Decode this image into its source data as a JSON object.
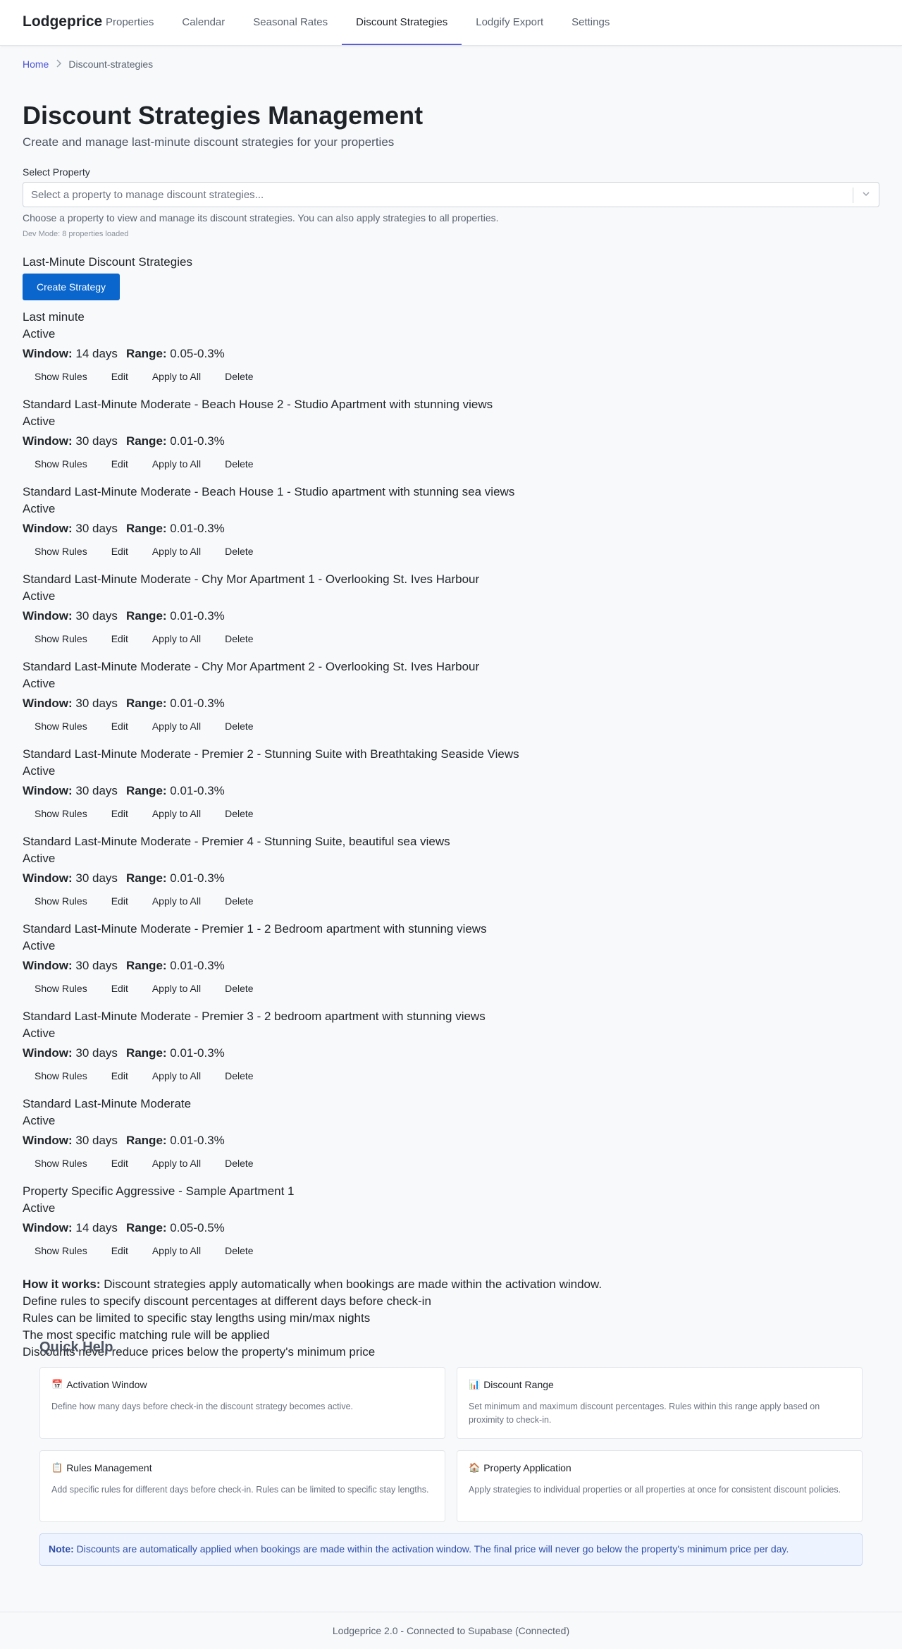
{
  "header": {
    "brand": "Lodgeprice",
    "nav": [
      {
        "label": "Properties",
        "active": false
      },
      {
        "label": "Calendar",
        "active": false
      },
      {
        "label": "Seasonal Rates",
        "active": false
      },
      {
        "label": "Discount Strategies",
        "active": true
      },
      {
        "label": "Lodgify Export",
        "active": false
      },
      {
        "label": "Settings",
        "active": false
      }
    ]
  },
  "breadcrumb": {
    "home": "Home",
    "current": "Discount-strategies"
  },
  "page": {
    "title": "Discount Strategies Management",
    "subtitle": "Create and manage last-minute discount strategies for your properties"
  },
  "property_select": {
    "label": "Select Property",
    "placeholder": "Select a property to manage discount strategies...",
    "help": "Choose a property to view and manage its discount strategies. You can also apply strategies to all properties.",
    "dev_mode": "Dev Mode: 8 properties loaded"
  },
  "strategies_section": {
    "title": "Last-Minute Discount Strategies",
    "create_label": "Create Strategy",
    "window_label": "Window:",
    "range_label": "Range:",
    "actions": {
      "show_rules": "Show Rules",
      "edit": "Edit",
      "apply_all": "Apply to All",
      "delete": "Delete"
    },
    "items": [
      {
        "name": "Last minute",
        "status": "Active",
        "window": "14 days",
        "range": "0.05-0.3%"
      },
      {
        "name": "Standard Last-Minute Moderate - Beach House 2 - Studio Apartment with stunning views",
        "status": "Active",
        "window": "30 days",
        "range": "0.01-0.3%"
      },
      {
        "name": "Standard Last-Minute Moderate - Beach House 1 - Studio apartment with stunning sea views",
        "status": "Active",
        "window": "30 days",
        "range": "0.01-0.3%"
      },
      {
        "name": "Standard Last-Minute Moderate - Chy Mor Apartment 1 - Overlooking St. Ives Harbour",
        "status": "Active",
        "window": "30 days",
        "range": "0.01-0.3%"
      },
      {
        "name": "Standard Last-Minute Moderate - Chy Mor Apartment 2 - Overlooking St. Ives Harbour",
        "status": "Active",
        "window": "30 days",
        "range": "0.01-0.3%"
      },
      {
        "name": "Standard Last-Minute Moderate - Premier 2 - Stunning Suite with Breathtaking Seaside Views",
        "status": "Active",
        "window": "30 days",
        "range": "0.01-0.3%"
      },
      {
        "name": "Standard Last-Minute Moderate - Premier 4 - Stunning Suite, beautiful sea views",
        "status": "Active",
        "window": "30 days",
        "range": "0.01-0.3%"
      },
      {
        "name": "Standard Last-Minute Moderate - Premier 1 - 2 Bedroom apartment with stunning views",
        "status": "Active",
        "window": "30 days",
        "range": "0.01-0.3%"
      },
      {
        "name": "Standard Last-Minute Moderate - Premier 3 - 2 bedroom apartment with stunning views",
        "status": "Active",
        "window": "30 days",
        "range": "0.01-0.3%"
      },
      {
        "name": "Standard Last-Minute Moderate",
        "status": "Active",
        "window": "30 days",
        "range": "0.01-0.3%"
      },
      {
        "name": "Property Specific Aggressive - Sample Apartment 1",
        "status": "Active",
        "window": "14 days",
        "range": "0.05-0.5%"
      }
    ]
  },
  "how_it_works": {
    "label": "How it works:",
    "text": " Discount strategies apply automatically when bookings are made within the activation window.",
    "points": [
      "Define rules to specify discount percentages at different days before check-in",
      "Rules can be limited to specific stay lengths using min/max nights",
      "The most specific matching rule will be applied",
      "Discounts never reduce prices below the property's minimum price"
    ]
  },
  "quick_help": {
    "title": "Quick Help",
    "cards": [
      {
        "icon": "calendar-icon",
        "emoji": "📅",
        "title": "Activation Window",
        "desc": "Define how many days before check-in the discount strategy becomes active."
      },
      {
        "icon": "chart-icon",
        "emoji": "📊",
        "title": "Discount Range",
        "desc": "Set minimum and maximum discount percentages. Rules within this range apply based on proximity to check-in."
      },
      {
        "icon": "clipboard-icon",
        "emoji": "📋",
        "title": "Rules Management",
        "desc": "Add specific rules for different days before check-in. Rules can be limited to specific stay lengths."
      },
      {
        "icon": "house-icon",
        "emoji": "🏠",
        "title": "Property Application",
        "desc": "Apply strategies to individual properties or all properties at once for consistent discount policies."
      }
    ],
    "note_label": "Note:",
    "note_text": " Discounts are automatically applied when bookings are made within the activation window. The final price will never go below the property's minimum price per day."
  },
  "footer": {
    "text": "Lodgeprice 2.0 - Connected to Supabase (Connected)"
  }
}
